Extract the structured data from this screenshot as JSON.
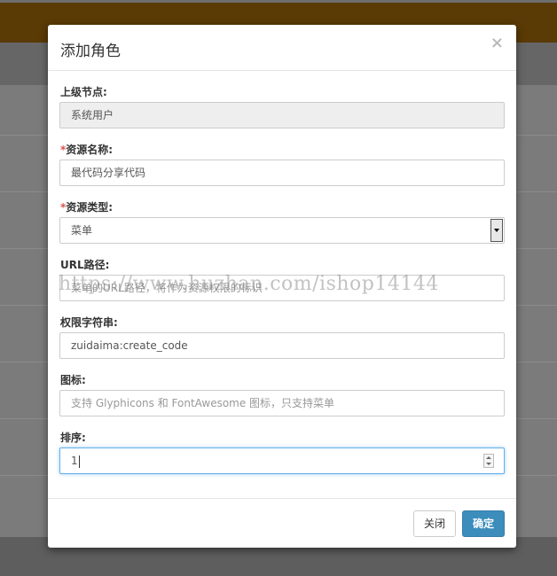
{
  "modal": {
    "title": "添加角色",
    "close_glyph": "×"
  },
  "fields": {
    "parent": {
      "label": "上级节点:",
      "value": "系统用户"
    },
    "name": {
      "required_mark": "*",
      "label": "资源名称:",
      "value": "最代码分享代码"
    },
    "type": {
      "required_mark": "*",
      "label": "资源类型:",
      "selected": "菜单"
    },
    "url": {
      "label": "URL路径:",
      "placeholder": "菜单的URL路径，将作为资源权限的标识"
    },
    "permission": {
      "label": "权限字符串:",
      "value": "zuidaima:create_code"
    },
    "icon": {
      "label": "图标:",
      "placeholder": "支持 Glyphicons 和 FontAwesome 图标，只支持菜单"
    },
    "sort": {
      "label": "排序:",
      "value": "1"
    }
  },
  "watermark": "https://www.huzhan.com/ishop14144",
  "footer": {
    "close_label": "关闭",
    "ok_label": "确定"
  },
  "colors": {
    "primary": "#3c8dbc",
    "required": "#d9534f",
    "focus": "#66afe9"
  },
  "icons": {
    "close": "close-icon",
    "select": "chevron-down-icon",
    "spinner": "number-stepper-icon"
  }
}
